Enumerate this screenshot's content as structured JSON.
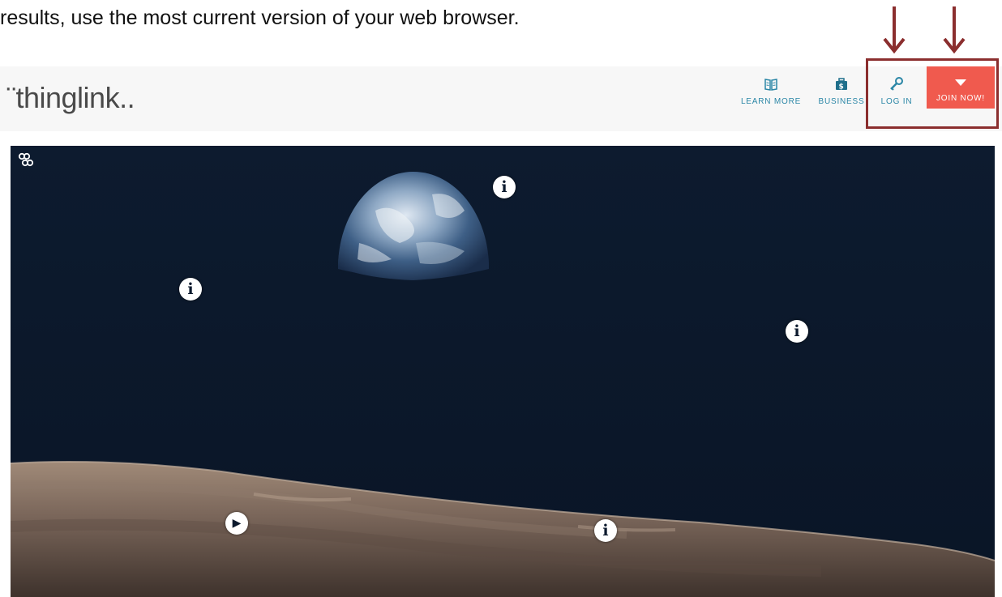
{
  "instruction_text": "results, use the most current version of your web browser.",
  "annotations": {
    "arrow_color": "#8b2e2e",
    "box_color": "#8b2e2e"
  },
  "header": {
    "logo_text": "¨thinglink..",
    "nav": {
      "learn_more": {
        "label": "LEARN MORE",
        "icon": "book-icon"
      },
      "business": {
        "label": "BUSINESS",
        "icon": "briefcase-dollar-icon"
      },
      "log_in": {
        "label": "LOG IN",
        "icon": "key-icon"
      },
      "join_now": {
        "label": "JOIN NOW!",
        "icon": "caret-down-icon"
      }
    },
    "accent_color": "#2a86a6",
    "join_color": "#f05a4e"
  },
  "media": {
    "description_icon": "thinglink-brand-icon",
    "hotspots": [
      {
        "type": "info",
        "glyph": "i"
      },
      {
        "type": "info",
        "glyph": "i"
      },
      {
        "type": "info",
        "glyph": "i"
      },
      {
        "type": "info",
        "glyph": "i"
      },
      {
        "type": "video",
        "glyph": "▶"
      }
    ]
  }
}
